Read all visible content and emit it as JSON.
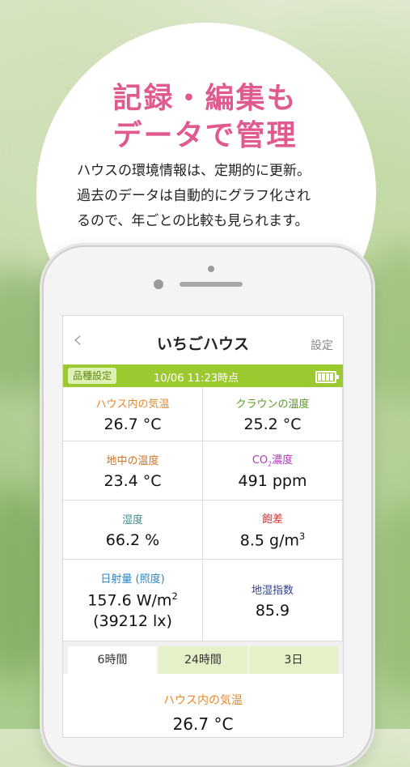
{
  "promo": {
    "headline_line1": "記録・編集も",
    "headline_line2": "データで管理",
    "desc_line1": "ハウスの環境情報は、定期的に更新。",
    "desc_line2": "過去のデータは自動的にグラフ化され",
    "desc_line3": "るので、年ごとの比較も見られます。"
  },
  "colors": {
    "accent_pink": "#e0598f",
    "status_green": "#9bc92f"
  },
  "app": {
    "back_icon": "chevron-left-icon",
    "title": "いちごハウス",
    "settings_label": "設定",
    "variety_label": "品種設定",
    "timestamp": "10/06 11:23時点",
    "battery_icon": "battery-full-icon"
  },
  "readings": {
    "air_temp": {
      "label": "ハウス内の気温",
      "value": "26.7 °C"
    },
    "crown_temp": {
      "label": "クラウンの温度",
      "value": "25.2 °C"
    },
    "soil_temp": {
      "label": "地中の温度",
      "value": "23.4 °C"
    },
    "co2": {
      "label_pre": "CO",
      "label_sub": "2",
      "label_post": "濃度",
      "value": "491 ppm"
    },
    "humidity": {
      "label": "湿度",
      "value": "66.2 %"
    },
    "saturation": {
      "label": "飽差",
      "value_pre": "8.5 g/m",
      "value_sup": "3"
    },
    "solar": {
      "label": "日射量 (照度)",
      "value_pre": "157.6 W/m",
      "value_sup": "2",
      "value_lux": "(39212 lx)"
    },
    "soil_moisture": {
      "label": "地湿指数",
      "value": "85.9"
    }
  },
  "tabs": [
    {
      "label": "6時間"
    },
    {
      "label": "24時間"
    },
    {
      "label": "3日"
    }
  ],
  "chart_preview": {
    "label": "ハウス内の気温",
    "value": "26.7 °C"
  }
}
